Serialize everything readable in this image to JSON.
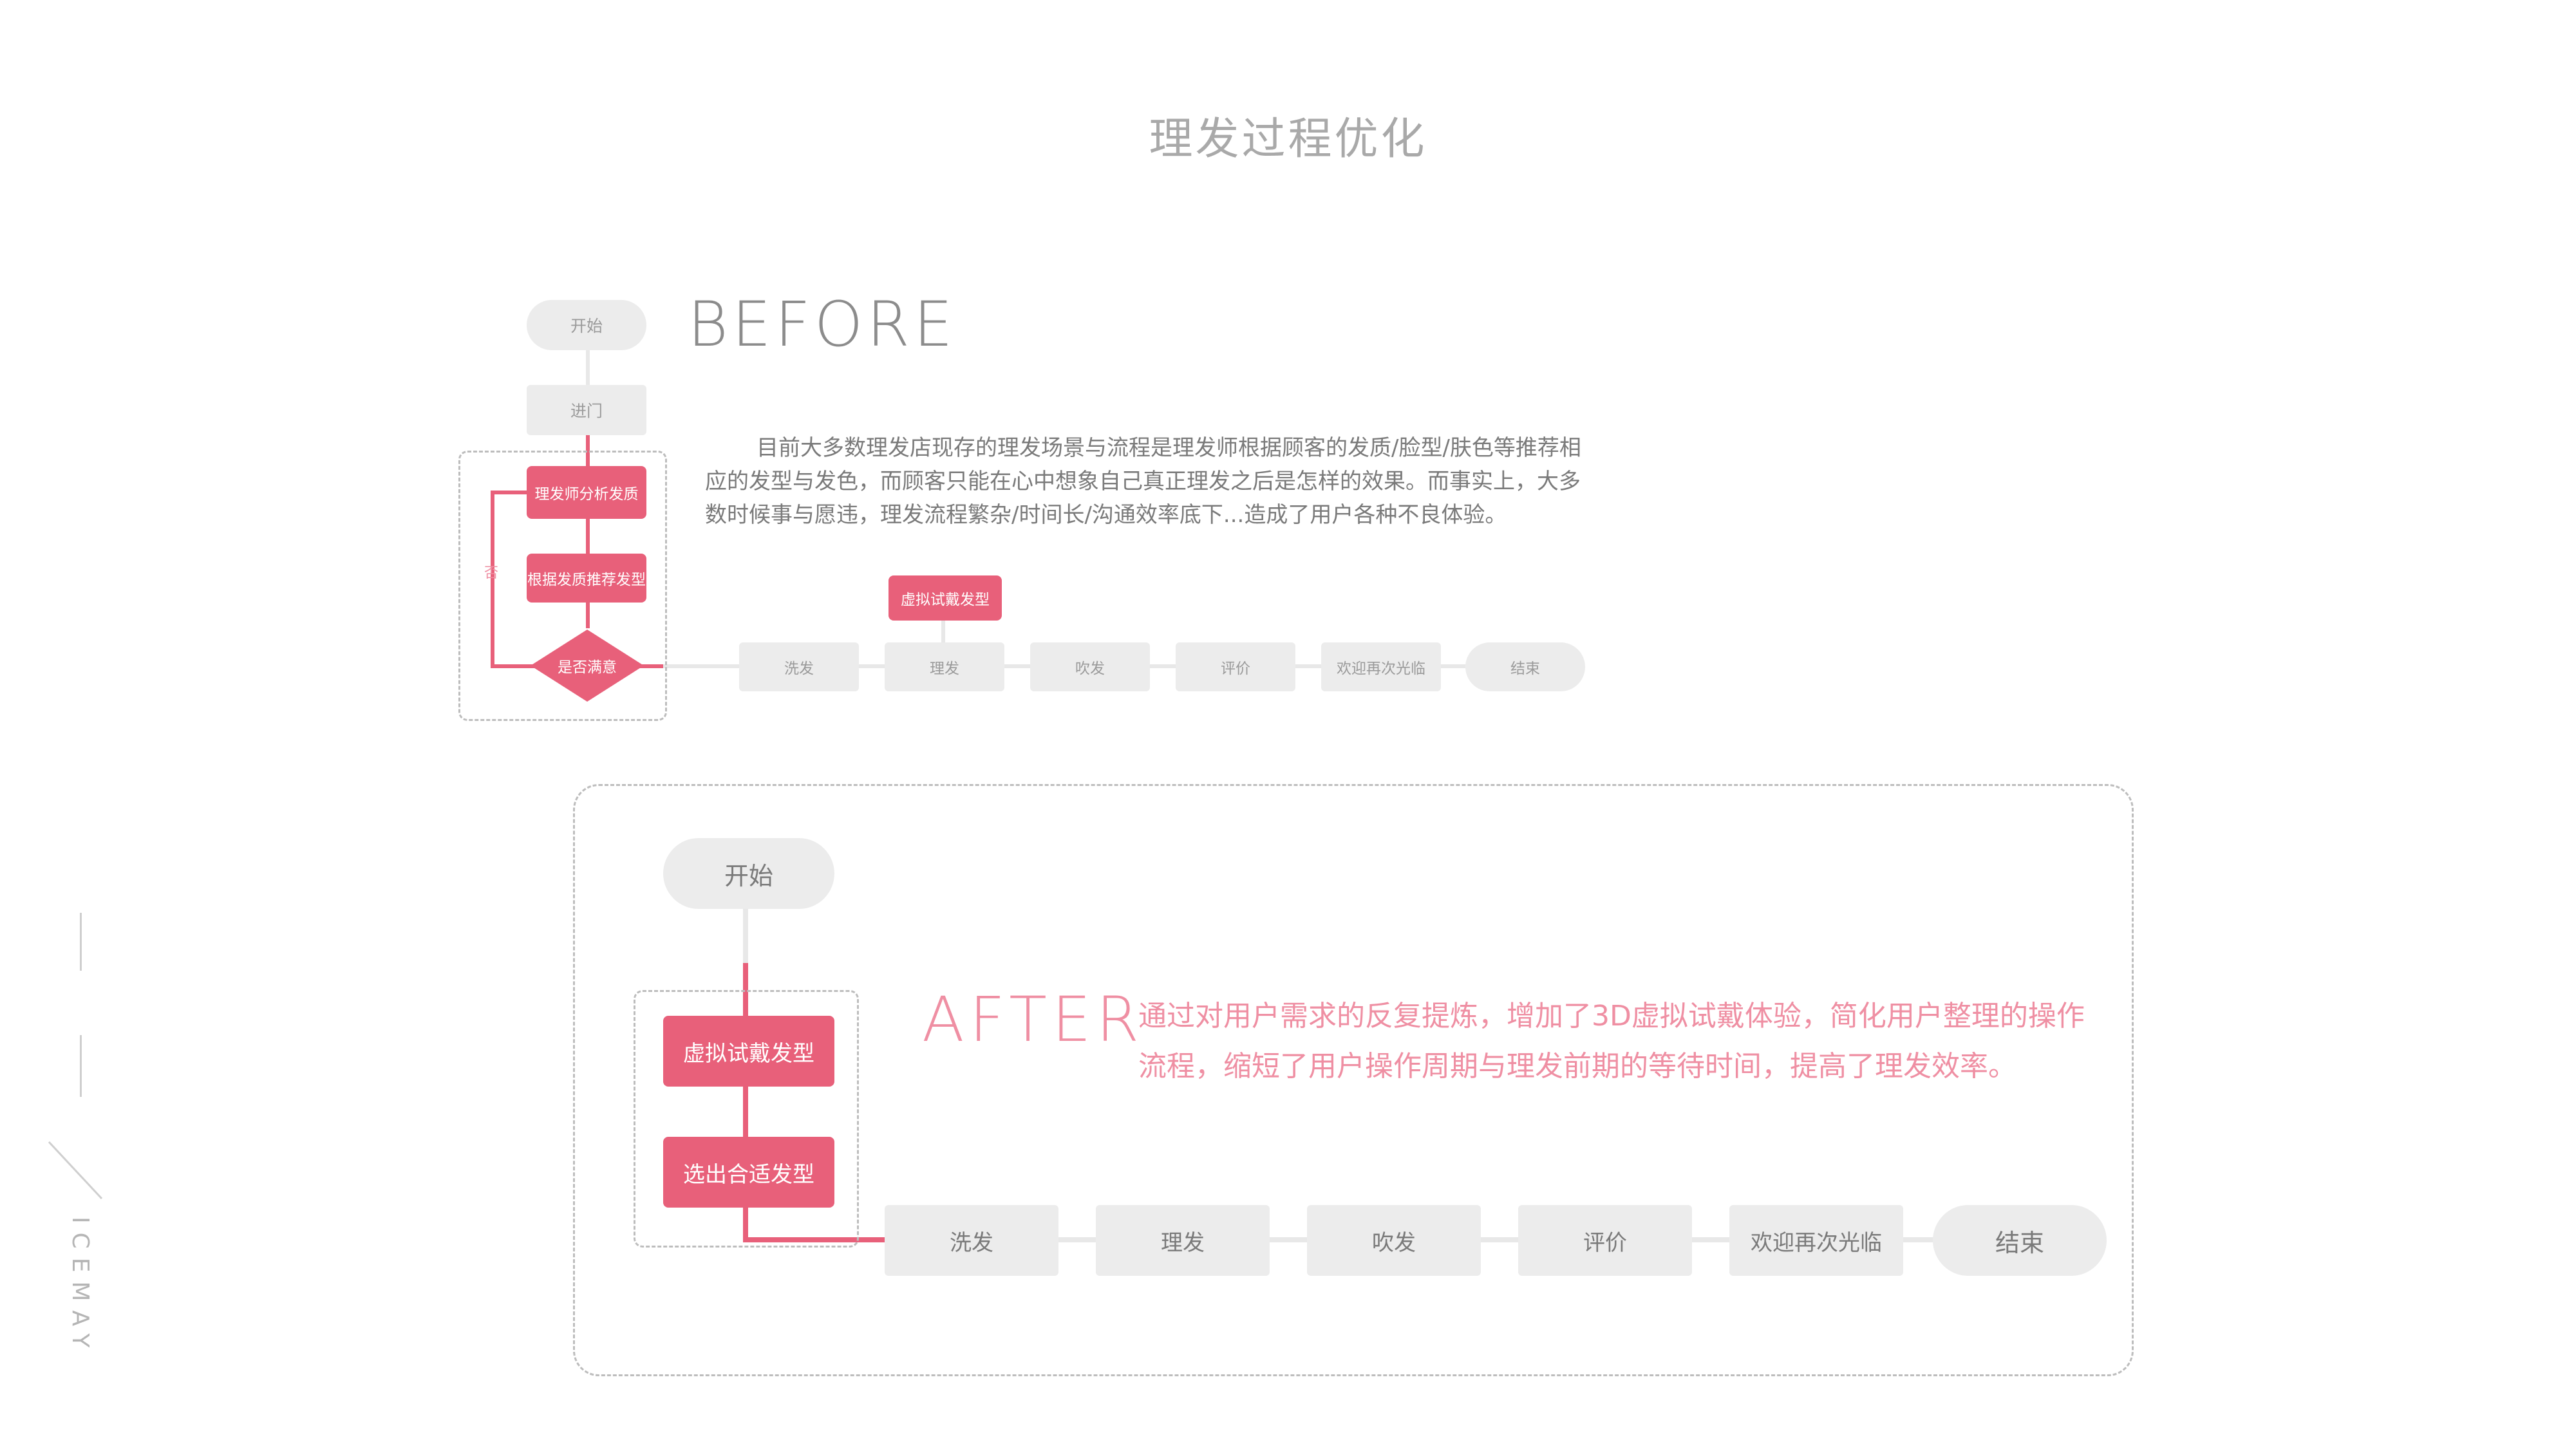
{
  "title": "理发过程优化",
  "before": {
    "heading": "BEFORE",
    "description": "目前大多数理发店现存的理发场景与流程是理发师根据顾客的发质/脸型/肤色等推荐相应的发型与发色，而顾客只能在心中想象自己真正理发之后是怎样的效果。而事实上，大多数时候事与愿违，理发流程繁杂/时间长/沟通效率底下...造成了用户各种不良体验。",
    "start": "开始",
    "enter": "进门",
    "analyze": "理发师分析发质",
    "recommend": "根据发质推荐发型",
    "decision": "是否满意",
    "no_label": "否",
    "virtual": "虚拟试戴发型",
    "steps": [
      "洗发",
      "理发",
      "吹发",
      "评价",
      "欢迎再次光临"
    ],
    "end": "结束"
  },
  "after": {
    "heading": "AFTER",
    "description": "通过对用户需求的反复提炼，增加了3D虚拟试戴体验，简化用户整理的操作流程，缩短了用户操作周期与理发前期的等待时间，提高了理发效率。",
    "start": "开始",
    "virtual": "虚拟试戴发型",
    "choose": "选出合适发型",
    "steps": [
      "洗发",
      "理发",
      "吹发",
      "评价",
      "欢迎再次光临"
    ],
    "end": "结束"
  },
  "side_label": "ICEMAY",
  "colors": {
    "accent": "#e8607a",
    "accent_light": "#ef8fa3",
    "node_gray": "#ececec",
    "text_gray": "#9a9a9a"
  }
}
